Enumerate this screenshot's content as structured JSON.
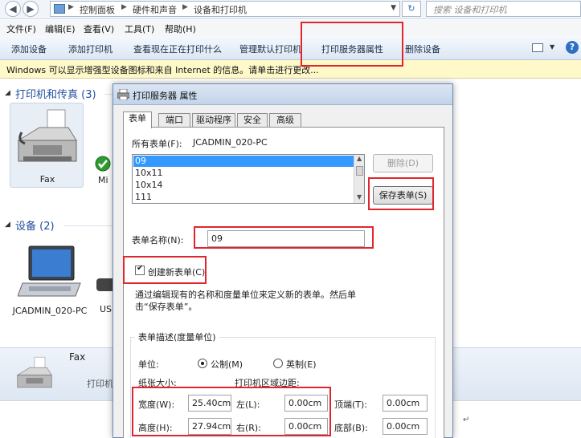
{
  "address": {
    "breadcrumbs": [
      "控制面板",
      "硬件和声音",
      "设备和打印机"
    ],
    "search_placeholder": "搜索 设备和打印机"
  },
  "menu": [
    "文件(F)",
    "编辑(E)",
    "查看(V)",
    "工具(T)",
    "帮助(H)"
  ],
  "commands": [
    "添加设备",
    "添加打印机",
    "查看现在正在打印什么",
    "管理默认打印机",
    "打印服务器属性",
    "删除设备"
  ],
  "infobar": "Windows 可以显示增强型设备图标和来自 Internet 的信息。请单击进行更改...",
  "sections": {
    "printers": "打印机和传真 (3)",
    "devices": "设备 (2)"
  },
  "printer_items": [
    {
      "label": "Fax"
    },
    {
      "label": "Mi"
    }
  ],
  "device_items": [
    {
      "label": "JCADMIN_020-PC"
    },
    {
      "label": "US"
    }
  ],
  "details": {
    "name": "Fax",
    "category": "打印机"
  },
  "dialog": {
    "title": "打印服务器 属性",
    "tabs": [
      "表单",
      "端口",
      "驱动程序",
      "安全",
      "高级"
    ],
    "all_forms_label": "所有表单(F):",
    "server_name": "JCADMIN_020-PC",
    "forms_list": [
      "09",
      "10x11",
      "10x14",
      "111"
    ],
    "delete_button": "删除(D)",
    "save_button": "保存表单(S)",
    "form_name_label": "表单名称(N):",
    "form_name_value": "09",
    "create_new_label": "创建新表单(C)",
    "description": "通过编辑现有的名称和度量单位来定义新的表单。然后单击“保存表单”。",
    "group_label": "表单描述(度量单位)",
    "units_label": "单位:",
    "metric_label": "公制(M)",
    "english_label": "英制(E)",
    "paper_size_label": "纸张大小:",
    "margins_label": "打印机区域边距:",
    "width_label": "宽度(W):",
    "width_value": "25.40cm",
    "height_label": "高度(H):",
    "height_value": "27.94cm",
    "left_label": "左(L):",
    "left_value": "0.00cm",
    "right_label": "右(R):",
    "right_value": "0.00cm",
    "top_label": "顶端(T):",
    "top_value": "0.00cm",
    "bottom_label": "底部(B):",
    "bottom_value": "0.00cm"
  },
  "colors": {
    "highlight_box": "#e0262c",
    "section_title": "#1f4e9c",
    "selection": "#3399ff"
  }
}
